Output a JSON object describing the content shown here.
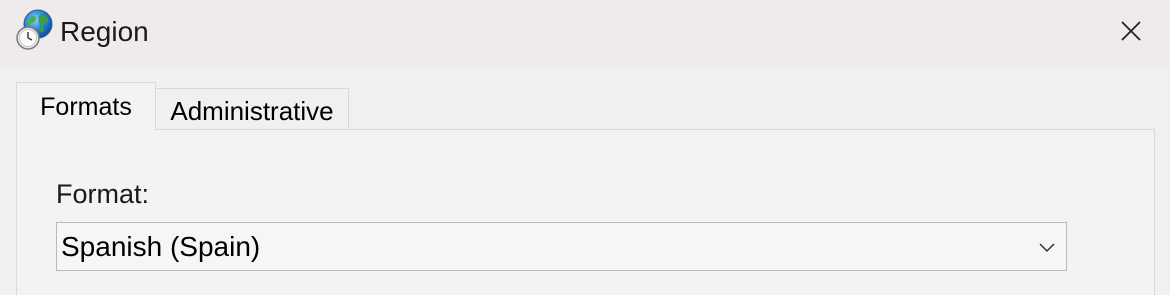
{
  "window": {
    "title": "Region",
    "app_icon": "globe-clock-icon",
    "close_icon": "close-icon"
  },
  "tabs": [
    {
      "label": "Formats",
      "selected": true
    },
    {
      "label": "Administrative",
      "selected": false
    }
  ],
  "formats": {
    "format_label": "Format:",
    "format_value": "Spanish (Spain)",
    "dropdown_icon": "chevron-down-icon"
  },
  "colors": {
    "titlebar_bg": "#efebea",
    "window_bg": "#f0f0f0",
    "border": "#d9d9d9"
  }
}
